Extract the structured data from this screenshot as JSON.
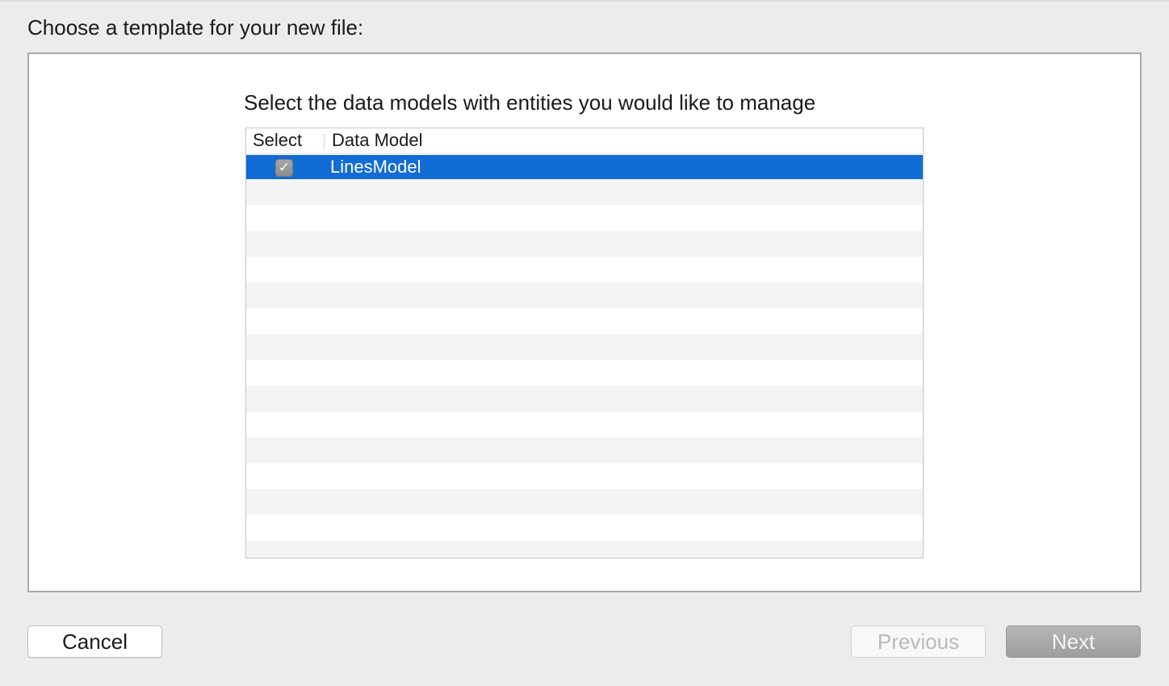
{
  "heading": "Choose a template for your new file:",
  "instruction": "Select the data models with entities you would like to manage",
  "table": {
    "columns": [
      "Select",
      "Data Model"
    ],
    "rows": [
      {
        "checked": true,
        "check_glyph": "✓",
        "model": "LinesModel",
        "selected": true
      }
    ]
  },
  "buttons": {
    "cancel": "Cancel",
    "previous": "Previous",
    "next": "Next"
  },
  "colors": {
    "selection": "#116cd6",
    "window_bg": "#ececec"
  }
}
